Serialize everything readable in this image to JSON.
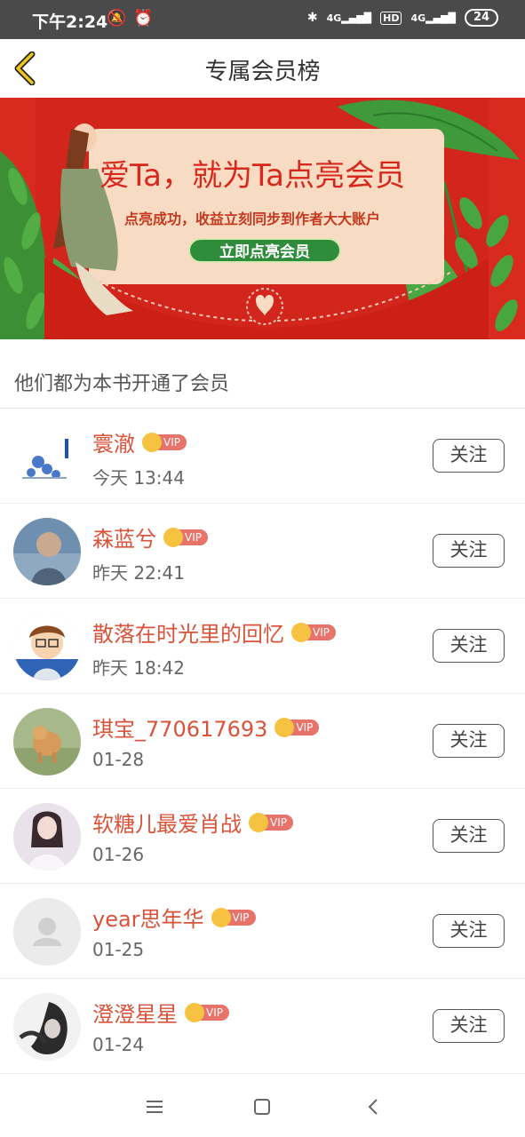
{
  "status_bar": {
    "time": "下午2:24",
    "left_icons": [
      "mute-icon",
      "alarm-icon"
    ],
    "right_icons": [
      "bluetooth-icon",
      "signal-4g-icon",
      "hd-icon",
      "signal-4g-icon"
    ],
    "net_label_1": "4G",
    "hd_label": "HD",
    "net_label_2": "4G",
    "battery": "24"
  },
  "nav": {
    "title": "专属会员榜",
    "back_icon": "chevron-left-icon"
  },
  "banner": {
    "headline": "爱Ta，就为Ta点亮会员",
    "subline": "点亮成功，收益立刻同步到作者大大账户",
    "cta": "立即点亮会员",
    "colors": {
      "background": "#d82a1f",
      "card": "#f7dcc3",
      "leaf": "#3f9a3c",
      "cta_bg": "#2f8c3a"
    }
  },
  "section": {
    "title": "他们都为本书开通了会员"
  },
  "members": [
    {
      "name": "寰澈",
      "badge": "VIP",
      "time": "今天 13:44",
      "follow": "关注"
    },
    {
      "name": "森蓝兮",
      "badge": "VIP",
      "time": "昨天 22:41",
      "follow": "关注"
    },
    {
      "name": "散落在时光里的回忆",
      "badge": "VIP",
      "time": "昨天 18:42",
      "follow": "关注"
    },
    {
      "name": "琪宝_770617693",
      "badge": "VIP",
      "time": "01-28",
      "follow": "关注"
    },
    {
      "name": "软糖儿最爱肖战",
      "badge": "VIP",
      "time": "01-26",
      "follow": "关注"
    },
    {
      "name": "year思年华",
      "badge": "VIP",
      "time": "01-25",
      "follow": "关注"
    },
    {
      "name": "澄澄星星",
      "badge": "VIP",
      "time": "01-24",
      "follow": "关注"
    }
  ],
  "system_nav": [
    "menu-icon",
    "home-icon",
    "back-icon"
  ],
  "colors": {
    "accent_name": "#d9533a",
    "vip_gold": "#f5c242",
    "vip_red": "#e8736a",
    "back_arrow": "#f0c419"
  }
}
